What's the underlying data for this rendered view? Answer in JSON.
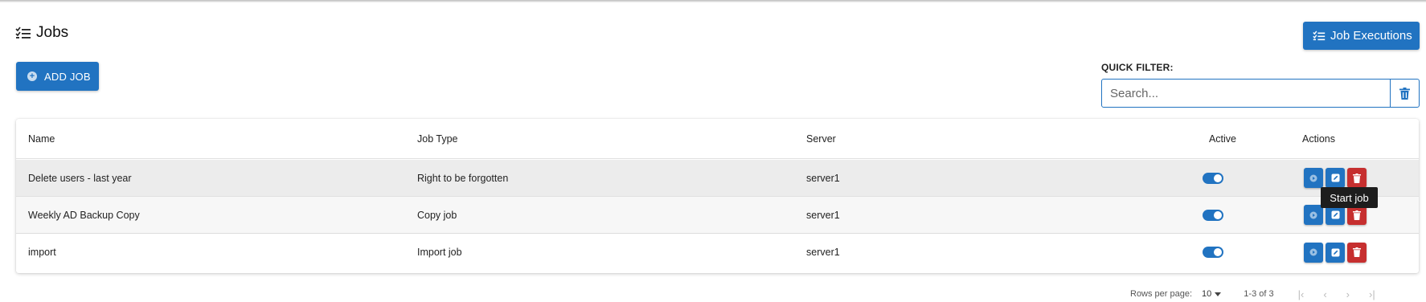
{
  "page": {
    "title": "Jobs"
  },
  "toolbar": {
    "add_job_label": "ADD JOB",
    "job_executions_label": "Job Executions"
  },
  "filter": {
    "label": "QUICK FILTER:",
    "placeholder": "Search...",
    "value": ""
  },
  "table": {
    "headers": {
      "name": "Name",
      "type": "Job Type",
      "server": "Server",
      "active": "Active",
      "actions": "Actions"
    },
    "rows": [
      {
        "name": "Delete users - last year",
        "type": "Right to be forgotten",
        "server": "server1",
        "active": true
      },
      {
        "name": "Weekly AD Backup Copy",
        "type": "Copy job",
        "server": "server1",
        "active": true
      },
      {
        "name": "import",
        "type": "Import job",
        "server": "server1",
        "active": true
      }
    ]
  },
  "tooltip": {
    "text": "Start job"
  },
  "pagination": {
    "rows_per_page_label": "Rows per page:",
    "rows_per_page_value": "10",
    "range": "1-3 of 3"
  },
  "colors": {
    "primary": "#2173c1",
    "danger": "#c62f2f"
  },
  "icons": {
    "title": "list-check-icon",
    "add": "plus-circle-icon",
    "exec": "list-check-icon",
    "clear": "trash-icon",
    "start": "play-icon",
    "edit": "edit-icon",
    "delete": "trash-icon"
  }
}
